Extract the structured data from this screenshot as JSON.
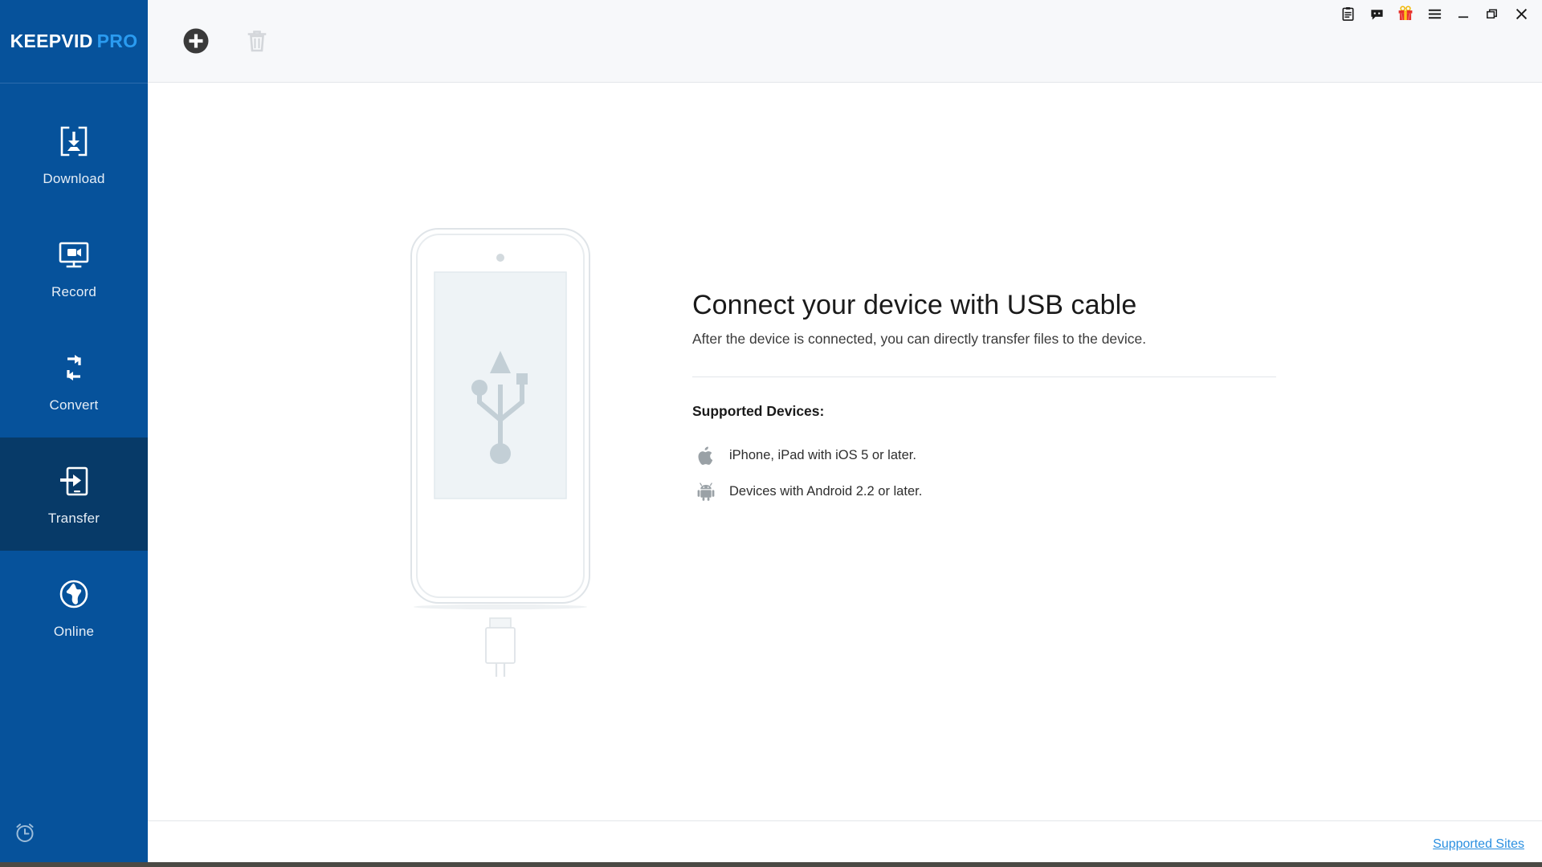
{
  "app": {
    "brand_primary": "KEEPVID",
    "brand_secondary": "PRO",
    "sidebar_bg": "#06529b",
    "sidebar_active_bg": "#073a68",
    "accent_blue": "#2a9bf0",
    "link_color": "#2a8fe0"
  },
  "titlebar": {
    "buttons": [
      {
        "name": "notes-icon",
        "label": "Notes"
      },
      {
        "name": "feedback-icon",
        "label": "Feedback"
      },
      {
        "name": "gift-icon",
        "label": "Gift"
      },
      {
        "name": "menu-icon",
        "label": "Menu"
      },
      {
        "name": "minimize-icon",
        "label": "Minimize"
      },
      {
        "name": "maximize-icon",
        "label": "Restore"
      },
      {
        "name": "close-icon",
        "label": "Close"
      }
    ]
  },
  "toolbar": {
    "add_label": "Add",
    "delete_label": "Delete",
    "delete_disabled": true
  },
  "sidebar": {
    "items": [
      {
        "label": "Download",
        "icon": "download-icon",
        "active": false
      },
      {
        "label": "Record",
        "icon": "record-icon",
        "active": false
      },
      {
        "label": "Convert",
        "icon": "convert-icon",
        "active": false
      },
      {
        "label": "Transfer",
        "icon": "transfer-icon",
        "active": true
      },
      {
        "label": "Online",
        "icon": "globe-icon",
        "active": false
      }
    ],
    "bottom_icon": "alarm-clock-icon"
  },
  "main": {
    "title": "Connect your device with USB cable",
    "subtitle": "After the device is connected, you can directly transfer files to the device.",
    "supported_heading": "Supported Devices:",
    "devices": [
      {
        "icon": "apple-icon",
        "text": "iPhone, iPad with iOS 5 or later."
      },
      {
        "icon": "android-icon",
        "text": "Devices with Android 2.2 or later."
      }
    ],
    "illustration": "phone-with-usb-cable"
  },
  "footer": {
    "supported_sites_label": "Supported Sites"
  }
}
